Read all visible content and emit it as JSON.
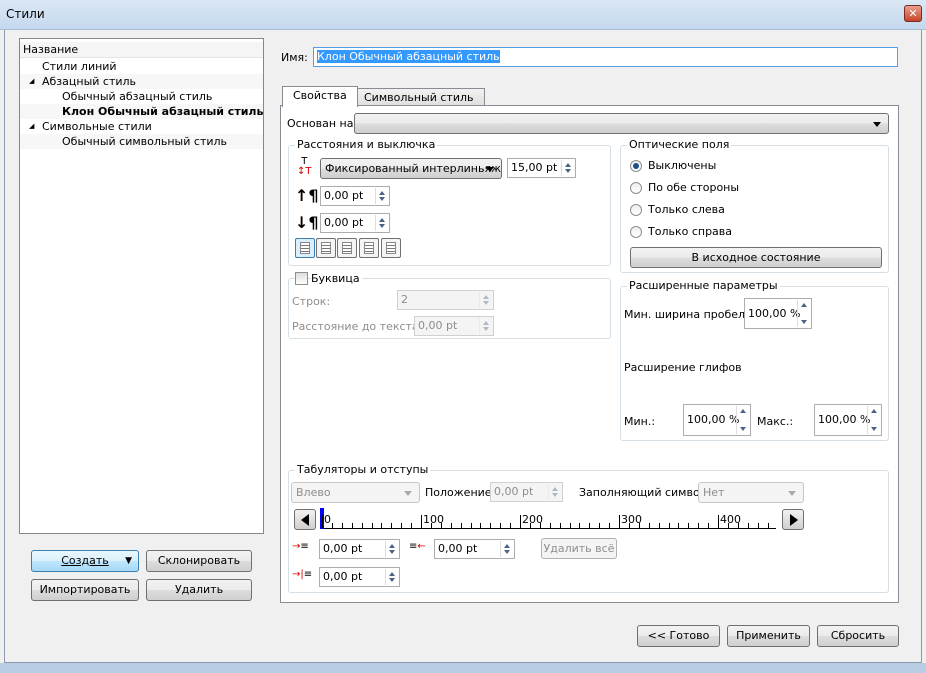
{
  "window": {
    "title": "Стили",
    "close_icon": "close-icon"
  },
  "tree": {
    "header": "Название",
    "items": [
      {
        "label": "Стили линий",
        "level": 1,
        "bold": false
      },
      {
        "label": "Абзацный стиль",
        "level": 1,
        "expanded": true
      },
      {
        "label": "Обычный абзацный стиль",
        "level": 2
      },
      {
        "label": "Клон Обычный абзацный стиль",
        "level": 2,
        "bold": true,
        "selected": true
      },
      {
        "label": "Символьные стили",
        "level": 1,
        "expanded": true
      },
      {
        "label": "Обычный символьный стиль",
        "level": 2
      }
    ]
  },
  "left_buttons": {
    "create": "Создать",
    "clone": "Склонировать",
    "import": "Импортировать",
    "delete": "Удалить"
  },
  "name": {
    "label": "Имя:",
    "value": "Клон Обычный абзацный стиль"
  },
  "tabs": [
    {
      "label": "Свойства",
      "active": true
    },
    {
      "label": "Символьный стиль",
      "active": false
    }
  ],
  "based_on": {
    "label": "Основан на:",
    "value": ""
  },
  "spacing": {
    "title": "Расстояния и выключка",
    "leading_mode": "Фиксированный интерлиньяж",
    "leading": "15,00 pt",
    "space_before": "0,00 pt",
    "space_after": "0,00 pt",
    "alignment": [
      "left",
      "center",
      "right",
      "justify",
      "force-justify"
    ],
    "alignment_selected": "left"
  },
  "dropcap": {
    "title": "Буквица",
    "checked": false,
    "lines_label": "Строк:",
    "lines": "2",
    "distance_label": "Расстояние до текста:",
    "distance": "0,00 pt"
  },
  "optical": {
    "title": "Оптические поля",
    "options": [
      "Выключены",
      "По обе стороны",
      "Только слева",
      "Только справа"
    ],
    "selected": 0,
    "reset": "В исходное состояние"
  },
  "advanced": {
    "title": "Расширенные параметры",
    "min_space_label": "Мин. ширина пробела:",
    "min_space": "100,00 %",
    "glyph_label": "Расширение глифов",
    "min_label": "Мин.:",
    "min": "100,00 %",
    "max_label": "Макс.:",
    "max": "100,00 %"
  },
  "tabstops": {
    "title": "Табуляторы и отступы",
    "align": "Влево",
    "position_label": "Положение:",
    "position": "0,00 pt",
    "fill_label": "Заполняющий символ:",
    "fill": "Нет",
    "ruler_labels": [
      "0",
      "100",
      "200",
      "300",
      "400"
    ],
    "first_indent": "0,00 pt",
    "right_indent": "0,00 pt",
    "left_indent": "0,00 pt",
    "delete_all": "Удалить всё"
  },
  "footer": {
    "done": "<< Готово",
    "apply": "Применить",
    "reset": "Сбросить"
  }
}
